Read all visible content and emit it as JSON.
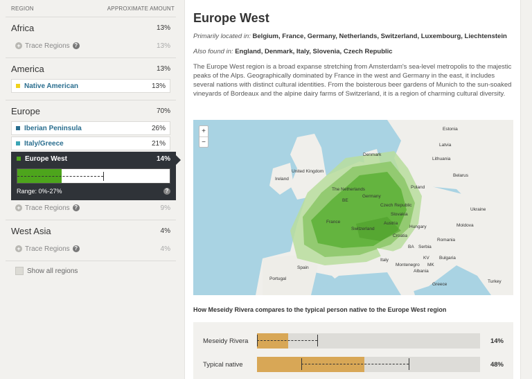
{
  "header": {
    "region": "REGION",
    "amount": "APPROXIMATE AMOUNT"
  },
  "groups": {
    "africa": {
      "name": "Africa",
      "pct": "13%",
      "trace": "Trace Regions",
      "trace_pct": "13%"
    },
    "america": {
      "name": "America",
      "pct": "13%",
      "sub": {
        "name": "Native American",
        "pct": "13%",
        "color": "#f0d21c"
      }
    },
    "europe": {
      "name": "Europe",
      "pct": "70%",
      "subs": [
        {
          "name": "Iberian Peninsula",
          "pct": "26%",
          "color": "#2a6e8f"
        },
        {
          "name": "Italy/Greece",
          "pct": "21%",
          "color": "#3aa5b5"
        }
      ],
      "active": {
        "name": "Europe West",
        "pct": "14%",
        "color": "#4da51c",
        "range_label": "Range: 0%-27%",
        "value": 14,
        "range_min": 0,
        "range_max": 27
      },
      "trace": "Trace Regions",
      "trace_pct": "9%"
    },
    "westasia": {
      "name": "West Asia",
      "pct": "4%",
      "trace": "Trace Regions",
      "trace_pct": "4%"
    }
  },
  "show_all": "Show all regions",
  "detail": {
    "title": "Europe West",
    "primary_label": "Primarily located in:",
    "primary": "Belgium, France, Germany, Netherlands, Switzerland, Luxembourg, Liechtenstein",
    "also_label": "Also found in:",
    "also": "England, Denmark, Italy, Slovenia, Czech Republic",
    "description": "The Europe West region is a broad expanse stretching from Amsterdam's sea-level metropolis to the majestic peaks of the Alps. Geographically dominated by France in the west and Germany in the east, it includes several nations with distinct cultural identities. From the boisterous beer gardens of Munich to the sun-soaked vineyards of Bordeaux and the alpine dairy farms of Switzerland, it is a region of charming cultural diversity."
  },
  "map": {
    "zoom_in": "+",
    "zoom_out": "−",
    "labels": [
      "Estonia",
      "Latvia",
      "Lithuania",
      "Denmark",
      "United Kingdom",
      "Ireland",
      "Belarus",
      "The Netherlands",
      "Poland",
      "BE",
      "Germany",
      "Czech Republic",
      "Ukraine",
      "Slovakia",
      "France",
      "Austria",
      "Hungary",
      "Moldova",
      "Switzerland",
      "Croatia",
      "Romania",
      "BA",
      "Serbia",
      "Italy",
      "KV",
      "Bulgaria",
      "Montenegro",
      "MK",
      "Spain",
      "Albania",
      "Portugal",
      "Greece",
      "Turkey"
    ]
  },
  "comparison": {
    "title": "How Meseidy Rivera compares to the typical person native to the Europe West region",
    "rows": [
      {
        "label": "Meseidy Rivera",
        "pct": "14%",
        "value": 14,
        "range_min": 0,
        "range_max": 27
      },
      {
        "label": "Typical native",
        "pct": "48%",
        "value": 48,
        "range_min": 20,
        "range_max": 68
      }
    ]
  }
}
